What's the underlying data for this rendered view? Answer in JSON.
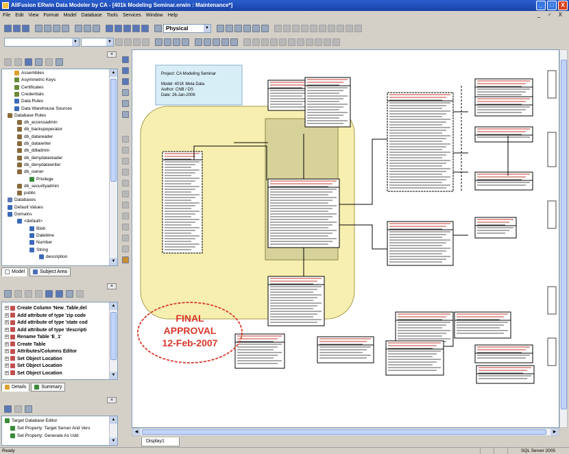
{
  "window": {
    "title": "AllFusion ERwin Data Modeler by CA - [401k Modeling Seminar.erwin : Maintenance*]",
    "minimize": "_",
    "maximize": "□",
    "close": "X",
    "mdi_controls": "_ ♂ X"
  },
  "menu": [
    "File",
    "Edit",
    "View",
    "Format",
    "Model",
    "Database",
    "Tools",
    "Services",
    "Window",
    "Help"
  ],
  "toolbar": {
    "view_mode": "Physical"
  },
  "model_tree": {
    "items": [
      {
        "label": "Assemblies",
        "icon": "assembly-icon"
      },
      {
        "label": "Asymmetric Keys",
        "icon": "key-icon"
      },
      {
        "label": "Certificates",
        "icon": "certificate-icon"
      },
      {
        "label": "Credentials",
        "icon": "credential-icon"
      },
      {
        "label": "Data Rules",
        "icon": "rule-icon"
      },
      {
        "label": "Data Warehouse Sources",
        "icon": "warehouse-icon"
      },
      {
        "label": "Database Roles",
        "icon": "role-icon"
      },
      {
        "label": "db_accessadmin",
        "icon": "role-icon"
      },
      {
        "label": "db_backupoperator",
        "icon": "role-icon"
      },
      {
        "label": "db_datareader",
        "icon": "role-icon"
      },
      {
        "label": "db_datawriter",
        "icon": "role-icon"
      },
      {
        "label": "db_ddladmin",
        "icon": "role-icon"
      },
      {
        "label": "db_denydatareader",
        "icon": "role-icon"
      },
      {
        "label": "db_denydatawriter",
        "icon": "role-icon"
      },
      {
        "label": "db_owner",
        "icon": "role-icon"
      },
      {
        "label": "Privilege",
        "icon": "privilege-icon"
      },
      {
        "label": "db_securityadmin",
        "icon": "role-icon"
      },
      {
        "label": "public",
        "icon": "role-icon"
      },
      {
        "label": "Databases",
        "icon": "database-icon"
      },
      {
        "label": "Default Values",
        "icon": "default-icon"
      },
      {
        "label": "Domains",
        "icon": "domain-icon"
      },
      {
        "label": "<default>",
        "icon": "domain-icon"
      },
      {
        "label": "Blob",
        "icon": "domain-icon"
      },
      {
        "label": "Datetime",
        "icon": "domain-icon"
      },
      {
        "label": "Number",
        "icon": "domain-icon"
      },
      {
        "label": "String",
        "icon": "domain-icon"
      },
      {
        "label": "description",
        "icon": "domain-icon"
      }
    ]
  },
  "model_tabs": [
    "Model",
    "Subject Area"
  ],
  "action_log": {
    "items": [
      "Create Column 'New_Table.del",
      "Add attribute of type 'zip code",
      "Add attribute of type 'state cod",
      "Add attribute of type 'descripti",
      "Rename Table 'E_1'",
      "Create Table",
      "Attributes/Columns Editor",
      "Set Object Location",
      "Set Object Location",
      "Set Object Location"
    ]
  },
  "action_tabs": [
    "Details",
    "Summary"
  ],
  "bottom_panel": {
    "items": [
      "Target Database Editor",
      "Set Property: Target Server And Vers",
      "Set Property: Generate As Udd"
    ]
  },
  "diagram": {
    "project_box": {
      "project": "Project: CA Modeling Seminar",
      "model": "Model: 401K Meta Data",
      "author": "Author: CNB / DS",
      "date": "Date: 26-Jan-2006"
    },
    "stamp": {
      "line1": "FINAL",
      "line2": "APPROVAL",
      "line3": "12-Feb-2007"
    }
  },
  "document_tab": "Display1",
  "status": {
    "left": "Ready",
    "server": "SQL Server 2005"
  },
  "colors": {
    "titlebar": "#1e4fb8",
    "subject_area_fill": "#f7efb0",
    "subject_area_inner": "#d6d29a",
    "stamp_red": "#d9372a",
    "project_box_fill": "#d8eef7"
  }
}
